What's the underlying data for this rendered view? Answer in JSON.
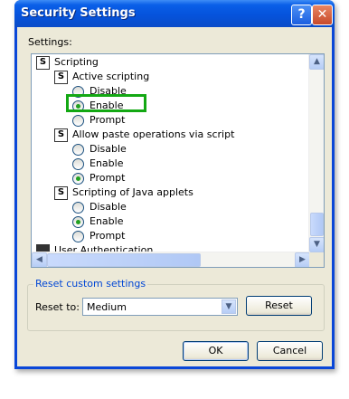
{
  "window": {
    "title": "Security Settings",
    "help_glyph": "?",
    "close_glyph": "✕"
  },
  "settings_label": "Settings:",
  "tree": {
    "cut_top_text": "",
    "items": [
      {
        "kind": "category",
        "label": "Scripting"
      },
      {
        "kind": "setting",
        "label": "Active scripting"
      },
      {
        "kind": "option",
        "label": "Disable",
        "selected": false
      },
      {
        "kind": "option",
        "label": "Enable",
        "selected": true
      },
      {
        "kind": "option",
        "label": "Prompt",
        "selected": false
      },
      {
        "kind": "setting",
        "label": "Allow paste operations via script"
      },
      {
        "kind": "option",
        "label": "Disable",
        "selected": false
      },
      {
        "kind": "option",
        "label": "Enable",
        "selected": false
      },
      {
        "kind": "option",
        "label": "Prompt",
        "selected": true
      },
      {
        "kind": "setting",
        "label": "Scripting of Java applets"
      },
      {
        "kind": "option",
        "label": "Disable",
        "selected": false
      },
      {
        "kind": "option",
        "label": "Enable",
        "selected": true
      },
      {
        "kind": "option",
        "label": "Prompt",
        "selected": false
      },
      {
        "kind": "category",
        "label": "User Authentication"
      }
    ],
    "highlight_color": "#13a813"
  },
  "reset_group": {
    "title": "Reset custom settings",
    "reset_to_label": "Reset to:",
    "selected_level": "Medium",
    "reset_button": "Reset"
  },
  "buttons": {
    "ok": "OK",
    "cancel": "Cancel"
  },
  "icons": {
    "scroll_up": "▲",
    "scroll_down": "▼",
    "scroll_left": "◀",
    "scroll_right": "▶",
    "dropdown": "▼",
    "script_glyph": "S"
  }
}
